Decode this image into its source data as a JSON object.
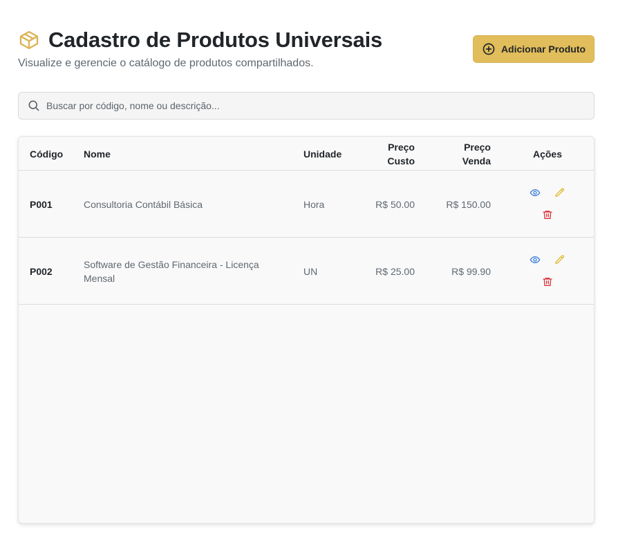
{
  "header": {
    "icon": "package-icon",
    "title": "Cadastro de Produtos Universais",
    "subtitle": "Visualize e gerencie o catálogo de produtos compartilhados.",
    "add_button_label": "Adicionar Produto",
    "add_button_icon": "plus-circle-icon"
  },
  "search": {
    "icon": "search-icon",
    "placeholder": "Buscar por código, nome ou descrição...",
    "value": ""
  },
  "table": {
    "columns": {
      "code": "Código",
      "name": "Nome",
      "unit": "Unidade",
      "cost_line1": "Preço",
      "cost_line2": "Custo",
      "sale_line1": "Preço",
      "sale_line2": "Venda",
      "actions": "Ações"
    },
    "rows": [
      {
        "code": "P001",
        "name": "Consultoria Contábil Básica",
        "unit": "Hora",
        "cost": "R$ 50.00",
        "sale": "R$ 150.00"
      },
      {
        "code": "P002",
        "name": "Software de Gestão Financeira - Licença Mensal",
        "unit": "UN",
        "cost": "R$ 25.00",
        "sale": "R$ 99.90"
      }
    ],
    "action_icons": [
      "eye-icon",
      "pencil-icon",
      "trash-icon"
    ]
  },
  "colors": {
    "accent": "#e1bd5b",
    "view": "#3b7dd8",
    "edit": "#e0b92c",
    "delete": "#d9363e"
  }
}
